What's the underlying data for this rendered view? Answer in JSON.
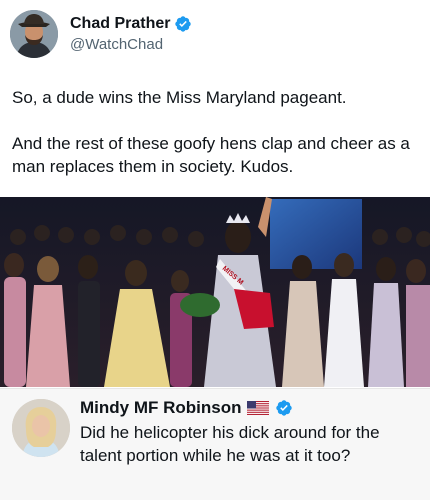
{
  "post": {
    "author_name": "Chad Prather",
    "author_handle": "@WatchChad",
    "verified_icon": "verified-badge-icon",
    "paragraphs": [
      "So, a dude wins the Miss Maryland pageant.",
      "And the rest of these goofy hens clap and cheer as a man replaces them in society. Kudos."
    ],
    "sash_text": "MISS M"
  },
  "reply": {
    "author_name": "Mindy MF Robinson",
    "flag_icon": "us-flag-icon",
    "verified_icon": "verified-badge-icon",
    "text": "Did he helicopter his dick around for the talent portion while he was at it too?"
  },
  "colors": {
    "verified_blue": "#1d9bf0",
    "reply_background": "#f7f7f7",
    "handle_gray": "#536471"
  }
}
